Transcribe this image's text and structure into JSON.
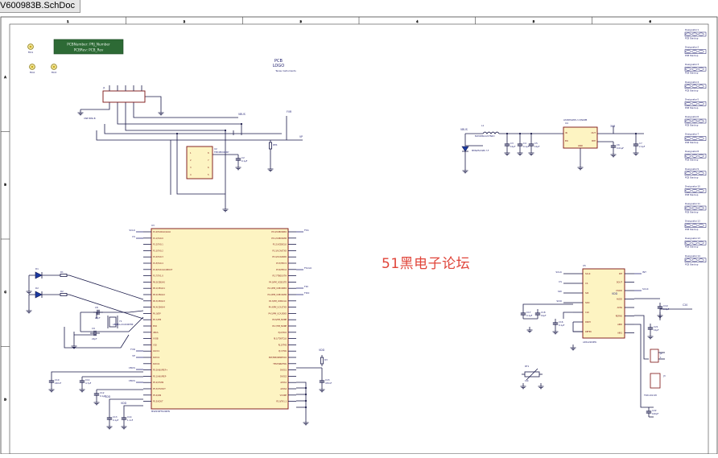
{
  "tab": {
    "title": "V600983B.SchDoc"
  },
  "border": {
    "columns": [
      "1",
      "2",
      "3",
      "4",
      "5",
      "6"
    ],
    "rows": [
      "A",
      "B",
      "C",
      "D"
    ]
  },
  "parameters": {
    "line1": "PCBNumber: PRJ_Number",
    "line2": "PCBRev: PCB_Rev"
  },
  "logo": {
    "line1": "PCB",
    "line2": "LOGO",
    "line3": "Texas Instruments"
  },
  "mounting": [
    "FID1",
    "FID2",
    "FID3"
  ],
  "nets": {
    "vbus": "VBUS",
    "gnd": "GND",
    "fvr": "FVR",
    "vp": "VP",
    "rtr": "RTR",
    "vdd": "VDD",
    "sclk": "SCLK",
    "cs": "CS",
    "sdi": "SDI",
    "sdo": "SDO",
    "fss": "FSS",
    "fsclk": "FSCLK",
    "fdi": "FDI",
    "fdo": "FDO",
    "int": "INT",
    "v18": "V1P8",
    "ldo": "LDO",
    "v33": "3V3",
    "mcu": "MCU"
  },
  "parts": {
    "j1": {
      "ref": "J1",
      "value": "USB MINI-B"
    },
    "u2": {
      "ref": "U2",
      "value": "TPD4E004DRY",
      "c": "C2",
      "cval": "0.1µF"
    },
    "l1": {
      "ref": "L1",
      "value": "BLM18SG121TN1D"
    },
    "d3": {
      "ref": "D3",
      "value": "MMSZ5232B-7-F"
    },
    "u4": {
      "ref": "U4",
      "value": "LP2985AIM5-3.3/NOPB",
      "in": "IN",
      "out": "OUT",
      "en": "EN",
      "byp": "BYP",
      "gnd": "GND"
    },
    "caps_ldo": [
      "C3",
      "C4",
      "C5",
      "C6",
      "C7"
    ],
    "cvals_ldo": [
      "10µF",
      "0.1µF",
      "10µF",
      "0.01µF",
      "2.2µF"
    ],
    "u3": {
      "ref": "U3",
      "value": "MSP430F5529IPN",
      "left_pins": [
        "P1.0/TA0CLK/ACLK",
        "P1.1/TA0.0",
        "P1.2/TA0.1",
        "P1.3/TA0.2",
        "P1.4/TA0.3",
        "P1.5/TA0.4",
        "P1.6/TA1CLK/CBOUT",
        "P1.7/TA1.0",
        "P6.0/CB0/A0",
        "P6.1/CB1/A1",
        "P6.2/CB2/A2",
        "P6.3/CB3/A3",
        "P6.4/CB4/A4",
        "PU.0/DP",
        "PU.1/DM",
        "PUR",
        "VBUS",
        "VUSB",
        "V18",
        "AVCC1",
        "DVCC1",
        "DVCC2",
        "P5.0/A8/VREF+",
        "P5.1/A9/VREF-",
        "P5.2/XT2IN",
        "P5.3/XT2OUT",
        "P5.4/XIN",
        "P5.5/XOUT"
      ],
      "right_pins": [
        "P3.0/UCB0SIMO",
        "P3.1/UCB0SOMI",
        "P3.2/UCB0CLK",
        "P3.3/UCA0TXD",
        "P3.4/UCA0RXD",
        "P3.5/TB0.5",
        "P3.6/TB0.6",
        "P3.7/TB0OUTH",
        "P4.0/PM_UCB1STE",
        "P4.1/PM_UCB1SIMO",
        "P4.2/PM_UCB1SOMI",
        "P4.3/PM_UCB1CLK",
        "P4.4/PM_UCA1TXD",
        "P4.5/PM_UCA1RXD",
        "P4.6/PM_NONE",
        "P4.7/PM_NONE",
        "PJ.0/TDO",
        "PJ.1/TDI/TCLK",
        "PJ.2/TMS",
        "PJ.3/TCK",
        "RST/NMI/SBWTDIO",
        "TEST/SBWTCK",
        "DVSS1",
        "DVSS2",
        "AVSS1",
        "AVSS2",
        "VCORE",
        "P2.0/TA1.1"
      ]
    },
    "diodes": [
      "D1",
      "D2"
    ],
    "resistors_d": [
      "R1",
      "R2"
    ],
    "crystal": {
      "ref": "Y1",
      "value": "ABM8G-24.000MHZ",
      "c1": "C8",
      "c2": "C9",
      "cval": "22pF"
    },
    "u5": {
      "ref": "U5",
      "value": "ADS1220IPW",
      "left_pins": [
        "SCLK",
        "CS",
        "SDI",
        "SDO",
        "CLK",
        "DRDY",
        "REFP0"
      ],
      "right_pins": [
        "INT",
        "DOUT",
        "DVDD",
        "AVDD",
        "AVSS",
        "REFN0",
        "AIN0",
        "AIN1"
      ]
    },
    "j2": {
      "ref": "J2",
      "value": "HEADER"
    },
    "j3": {
      "ref": "J3",
      "value": "TSW-102-08"
    },
    "rt1": {
      "ref": "RT1",
      "value": "10k"
    },
    "caps_mcu": [
      "C10",
      "C11",
      "C12",
      "C13",
      "C14",
      "C15"
    ],
    "cvals_mcu": [
      "220nF",
      "4.7µF",
      "0.1µF",
      "0.1µF",
      "1.1nF",
      "470nF"
    ]
  },
  "designators": [
    "Designator1",
    "Designator2",
    "Designator3",
    "Designator4",
    "Designator5",
    "Designator6",
    "Designator7",
    "Designator8",
    "Designator9",
    "Designator10",
    "Designator11",
    "Designator12",
    "Designator13",
    "Designator14"
  ],
  "designator_caption": "PCB Stackup",
  "watermark": "51黑电子论坛"
}
